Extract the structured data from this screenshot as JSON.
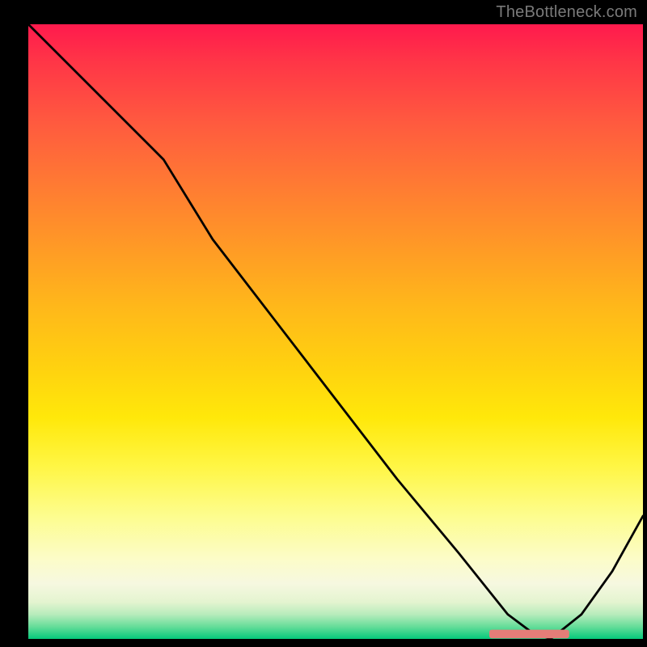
{
  "attribution": "TheBottleneck.com",
  "colors": {
    "background": "#000000",
    "text": "#7a7a7a",
    "curve": "#000000",
    "marker": "#e57d78",
    "gradient_top": "#ff1a4d",
    "gradient_bottom": "#05c97b"
  },
  "chart_data": {
    "type": "line",
    "title": "",
    "xlabel": "",
    "ylabel": "",
    "xlim": [
      0,
      100
    ],
    "ylim": [
      0,
      100
    ],
    "grid": false,
    "legend": false,
    "x": [
      0,
      10,
      20,
      22,
      30,
      40,
      50,
      60,
      70,
      78,
      82,
      85,
      90,
      95,
      100
    ],
    "values": [
      100,
      90,
      80,
      78,
      65,
      52,
      39,
      26,
      14,
      4,
      1,
      0,
      4,
      11,
      20
    ],
    "marker_band": {
      "x0": 75,
      "x1": 88,
      "y": 0.8,
      "thickness": 1.4
    },
    "note": "x/y are percentages of the plot area; curve estimated from pixels"
  }
}
